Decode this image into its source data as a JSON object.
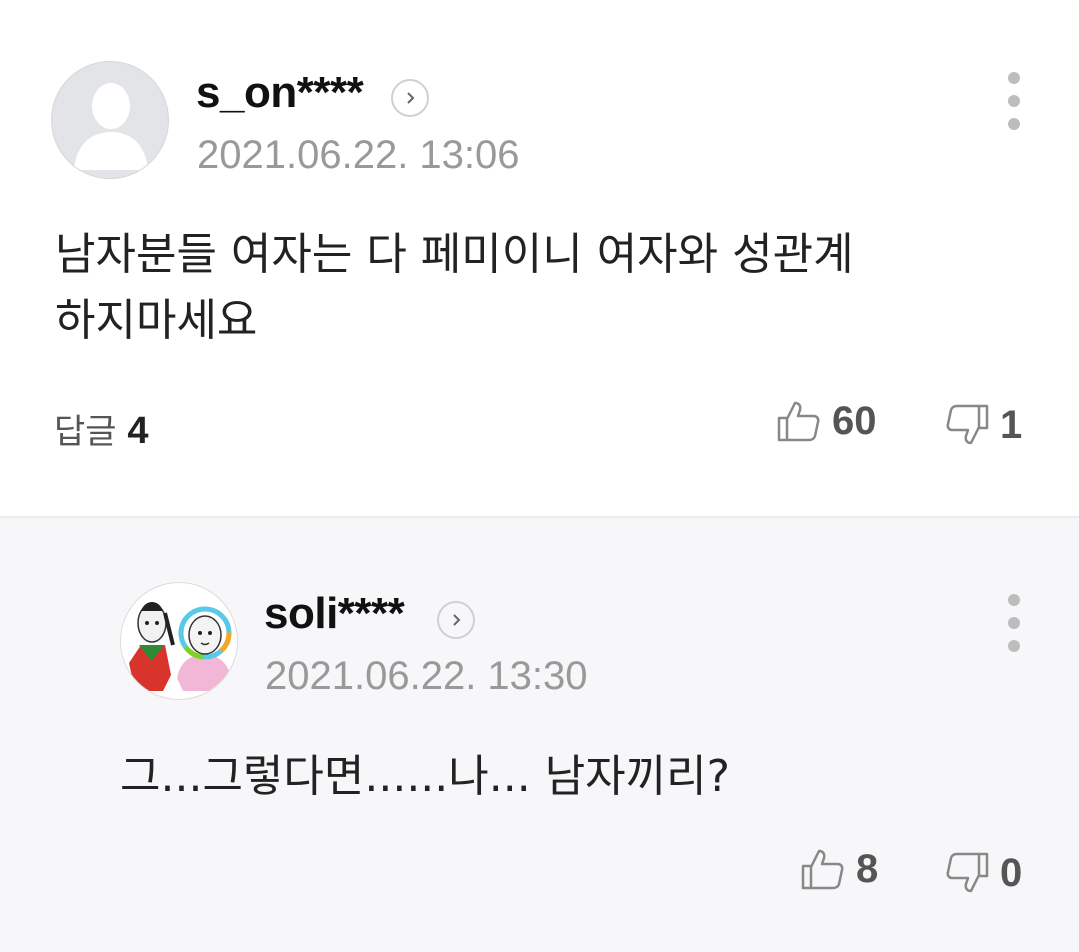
{
  "comments": [
    {
      "nickname": "s_on****",
      "datetime": "2021.06.22. 13:06",
      "text": "남자분들 여자는 다 페미이니 여자와 성관계\n하지마세요",
      "replies_label": "답글",
      "replies_count": "4",
      "likes": "60",
      "dislikes": "1",
      "avatar": "default-profile-icon"
    },
    {
      "nickname": "soli****",
      "datetime": "2021.06.22. 13:30",
      "text": "그...그렇다면......나... 남자끼리?",
      "likes": "8",
      "dislikes": "0",
      "avatar": "cartoon-profile-picture"
    }
  ],
  "colors": {
    "reply_background": "#f7f7f9",
    "muted_text": "#999999",
    "icon_gray": "#bdbdbd"
  }
}
